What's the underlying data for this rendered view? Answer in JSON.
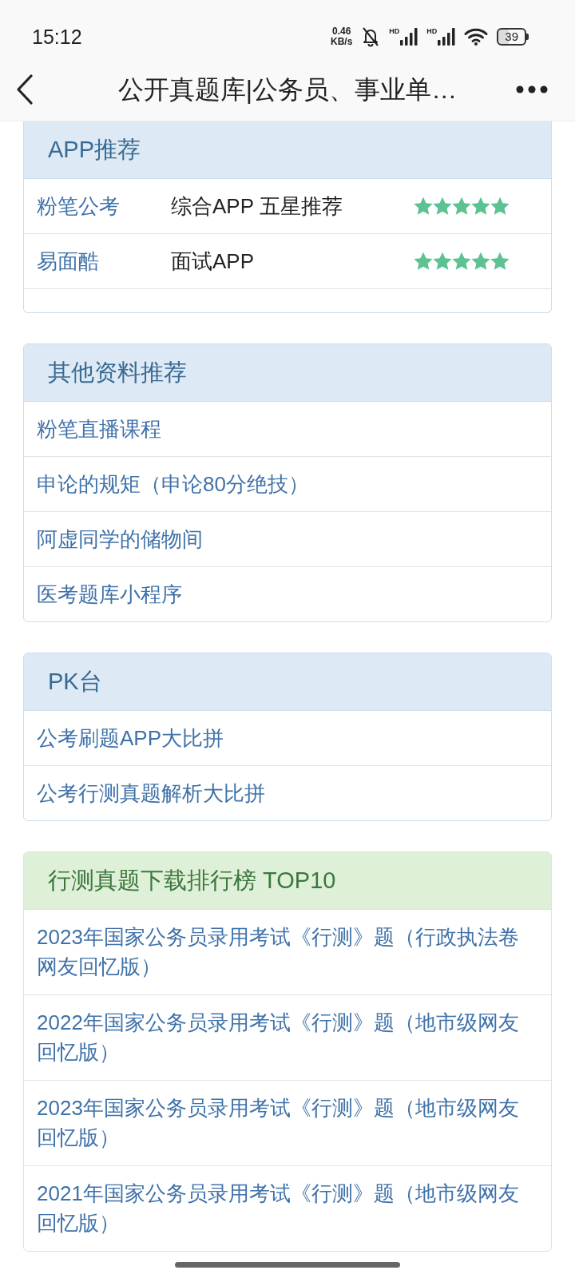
{
  "status_bar": {
    "time": "15:12",
    "net_speed": "0.46",
    "net_speed_unit": "KB/s",
    "networks": [
      {
        "label": "HD"
      },
      {
        "label": "HD"
      }
    ],
    "battery": "39"
  },
  "nav_bar": {
    "title": "公开真题库|公务员、事业单…"
  },
  "panels": [
    {
      "kind": "rating-table",
      "title": "APP推荐",
      "rows": [
        {
          "name": "粉笔公考",
          "description": "综合APP 五星推荐",
          "stars": 5
        },
        {
          "name": "易面酷",
          "description": "面试APP",
          "stars": 5
        }
      ]
    },
    {
      "kind": "link-list",
      "title": "其他资料推荐",
      "links": [
        "粉笔直播课程",
        "申论的规矩（申论80分绝技）",
        "阿虚同学的储物间",
        "医考题库小程序"
      ]
    },
    {
      "kind": "link-list",
      "title": "PK台",
      "links": [
        "公考刷题APP大比拼",
        "公考行测真题解析大比拼"
      ]
    },
    {
      "kind": "ranking-list",
      "title": "行测真题下载排行榜 TOP10",
      "links": [
        "2023年国家公务员录用考试《行测》题（行政执法卷网友回忆版）",
        "2022年国家公务员录用考试《行测》题（地市级网友回忆版）",
        "2023年国家公务员录用考试《行测》题（地市级网友回忆版）",
        "2021年国家公务员录用考试《行测》题（地市级网友回忆版）"
      ]
    }
  ]
}
